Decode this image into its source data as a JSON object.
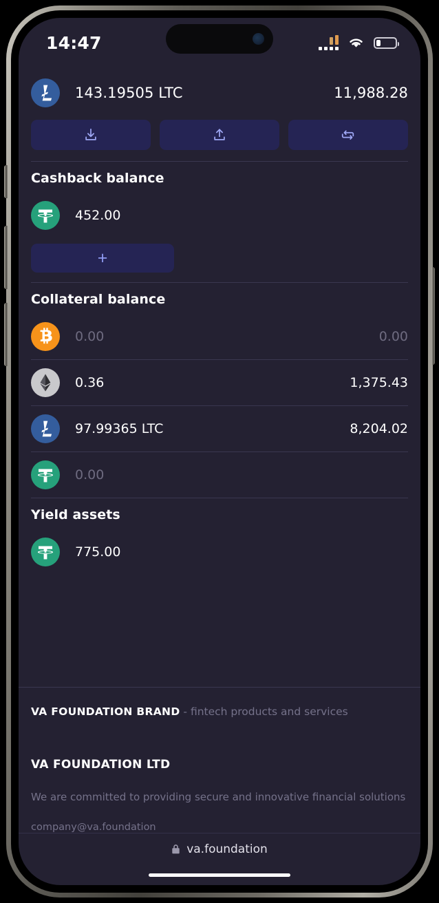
{
  "status_bar": {
    "time": "14:47",
    "cellular_icon": "cellular-bars-icon",
    "wifi_icon": "wifi-icon",
    "battery_icon": "battery-low-icon",
    "battery_level_percent": 22
  },
  "main_balance": {
    "coin": "LTC",
    "coin_icon": "litecoin-icon",
    "amount": "143.19505 LTC",
    "fiat": "11,988.28"
  },
  "actions": [
    {
      "name": "receive",
      "icon": "download-arrow-icon"
    },
    {
      "name": "send",
      "icon": "upload-arrow-icon"
    },
    {
      "name": "swap",
      "icon": "swap-arrows-icon"
    }
  ],
  "cashback": {
    "title": "Cashback balance",
    "assets": [
      {
        "coin": "USDT",
        "coin_icon": "tether-icon",
        "amount": "452.00",
        "fiat": "",
        "muted": false
      }
    ],
    "add_label": "+"
  },
  "collateral": {
    "title": "Collateral balance",
    "assets": [
      {
        "coin": "BTC",
        "coin_icon": "bitcoin-icon",
        "amount": "0.00",
        "fiat": "0.00",
        "muted": true
      },
      {
        "coin": "ETH",
        "coin_icon": "ethereum-icon",
        "amount": "0.36",
        "fiat": "1,375.43",
        "muted": false
      },
      {
        "coin": "LTC",
        "coin_icon": "litecoin-icon",
        "amount": "97.99365 LTC",
        "fiat": "8,204.02",
        "muted": false
      },
      {
        "coin": "USDT",
        "coin_icon": "tether-icon",
        "amount": "0.00",
        "fiat": "",
        "muted": true
      }
    ]
  },
  "yield": {
    "title": "Yield assets",
    "assets": [
      {
        "coin": "USDT",
        "coin_icon": "tether-icon",
        "amount": "775.00",
        "fiat": "",
        "muted": false
      }
    ]
  },
  "footer": {
    "brand_name": "VA FOUNDATION BRAND",
    "brand_tagline": " - fintech products and services",
    "company": "VA FOUNDATION LTD",
    "mission": "We are committed to providing secure and innovative financial solutions",
    "email": "company@va.foundation"
  },
  "browser": {
    "lock_icon": "lock-icon",
    "url": "va.foundation"
  },
  "colors": {
    "background": "#242132",
    "divider": "#3a3750",
    "action_button_bg": "#252454",
    "accent": "#9fa8f5",
    "muted_text": "#6e6b80",
    "bitcoin": "#f7931a",
    "ethereum": "#c9c9cc",
    "litecoin": "#345d9d",
    "tether": "#26a17b"
  }
}
